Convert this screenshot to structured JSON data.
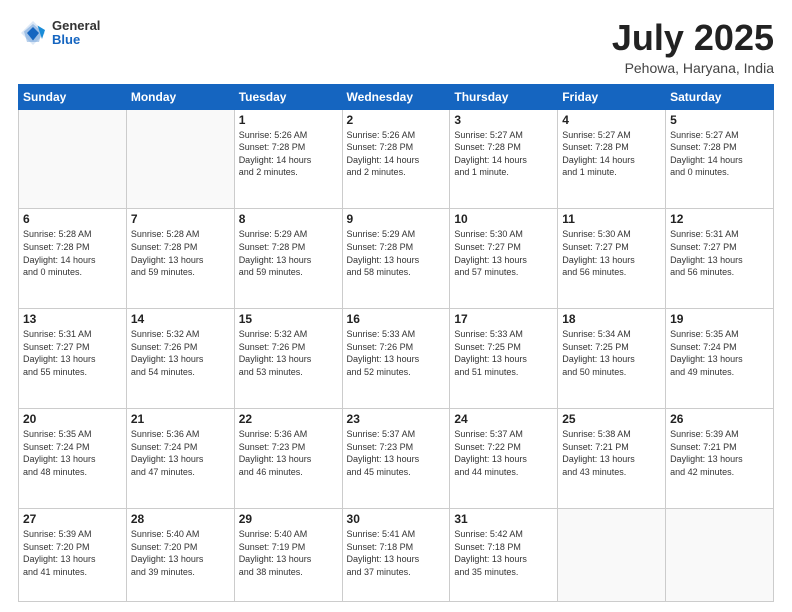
{
  "header": {
    "logo": {
      "general": "General",
      "blue": "Blue"
    },
    "title": "July 2025",
    "subtitle": "Pehowa, Haryana, India"
  },
  "weekdays": [
    "Sunday",
    "Monday",
    "Tuesday",
    "Wednesday",
    "Thursday",
    "Friday",
    "Saturday"
  ],
  "weeks": [
    [
      {
        "day": "",
        "info": ""
      },
      {
        "day": "",
        "info": ""
      },
      {
        "day": "1",
        "info": "Sunrise: 5:26 AM\nSunset: 7:28 PM\nDaylight: 14 hours\nand 2 minutes."
      },
      {
        "day": "2",
        "info": "Sunrise: 5:26 AM\nSunset: 7:28 PM\nDaylight: 14 hours\nand 2 minutes."
      },
      {
        "day": "3",
        "info": "Sunrise: 5:27 AM\nSunset: 7:28 PM\nDaylight: 14 hours\nand 1 minute."
      },
      {
        "day": "4",
        "info": "Sunrise: 5:27 AM\nSunset: 7:28 PM\nDaylight: 14 hours\nand 1 minute."
      },
      {
        "day": "5",
        "info": "Sunrise: 5:27 AM\nSunset: 7:28 PM\nDaylight: 14 hours\nand 0 minutes."
      }
    ],
    [
      {
        "day": "6",
        "info": "Sunrise: 5:28 AM\nSunset: 7:28 PM\nDaylight: 14 hours\nand 0 minutes."
      },
      {
        "day": "7",
        "info": "Sunrise: 5:28 AM\nSunset: 7:28 PM\nDaylight: 13 hours\nand 59 minutes."
      },
      {
        "day": "8",
        "info": "Sunrise: 5:29 AM\nSunset: 7:28 PM\nDaylight: 13 hours\nand 59 minutes."
      },
      {
        "day": "9",
        "info": "Sunrise: 5:29 AM\nSunset: 7:28 PM\nDaylight: 13 hours\nand 58 minutes."
      },
      {
        "day": "10",
        "info": "Sunrise: 5:30 AM\nSunset: 7:27 PM\nDaylight: 13 hours\nand 57 minutes."
      },
      {
        "day": "11",
        "info": "Sunrise: 5:30 AM\nSunset: 7:27 PM\nDaylight: 13 hours\nand 56 minutes."
      },
      {
        "day": "12",
        "info": "Sunrise: 5:31 AM\nSunset: 7:27 PM\nDaylight: 13 hours\nand 56 minutes."
      }
    ],
    [
      {
        "day": "13",
        "info": "Sunrise: 5:31 AM\nSunset: 7:27 PM\nDaylight: 13 hours\nand 55 minutes."
      },
      {
        "day": "14",
        "info": "Sunrise: 5:32 AM\nSunset: 7:26 PM\nDaylight: 13 hours\nand 54 minutes."
      },
      {
        "day": "15",
        "info": "Sunrise: 5:32 AM\nSunset: 7:26 PM\nDaylight: 13 hours\nand 53 minutes."
      },
      {
        "day": "16",
        "info": "Sunrise: 5:33 AM\nSunset: 7:26 PM\nDaylight: 13 hours\nand 52 minutes."
      },
      {
        "day": "17",
        "info": "Sunrise: 5:33 AM\nSunset: 7:25 PM\nDaylight: 13 hours\nand 51 minutes."
      },
      {
        "day": "18",
        "info": "Sunrise: 5:34 AM\nSunset: 7:25 PM\nDaylight: 13 hours\nand 50 minutes."
      },
      {
        "day": "19",
        "info": "Sunrise: 5:35 AM\nSunset: 7:24 PM\nDaylight: 13 hours\nand 49 minutes."
      }
    ],
    [
      {
        "day": "20",
        "info": "Sunrise: 5:35 AM\nSunset: 7:24 PM\nDaylight: 13 hours\nand 48 minutes."
      },
      {
        "day": "21",
        "info": "Sunrise: 5:36 AM\nSunset: 7:24 PM\nDaylight: 13 hours\nand 47 minutes."
      },
      {
        "day": "22",
        "info": "Sunrise: 5:36 AM\nSunset: 7:23 PM\nDaylight: 13 hours\nand 46 minutes."
      },
      {
        "day": "23",
        "info": "Sunrise: 5:37 AM\nSunset: 7:23 PM\nDaylight: 13 hours\nand 45 minutes."
      },
      {
        "day": "24",
        "info": "Sunrise: 5:37 AM\nSunset: 7:22 PM\nDaylight: 13 hours\nand 44 minutes."
      },
      {
        "day": "25",
        "info": "Sunrise: 5:38 AM\nSunset: 7:21 PM\nDaylight: 13 hours\nand 43 minutes."
      },
      {
        "day": "26",
        "info": "Sunrise: 5:39 AM\nSunset: 7:21 PM\nDaylight: 13 hours\nand 42 minutes."
      }
    ],
    [
      {
        "day": "27",
        "info": "Sunrise: 5:39 AM\nSunset: 7:20 PM\nDaylight: 13 hours\nand 41 minutes."
      },
      {
        "day": "28",
        "info": "Sunrise: 5:40 AM\nSunset: 7:20 PM\nDaylight: 13 hours\nand 39 minutes."
      },
      {
        "day": "29",
        "info": "Sunrise: 5:40 AM\nSunset: 7:19 PM\nDaylight: 13 hours\nand 38 minutes."
      },
      {
        "day": "30",
        "info": "Sunrise: 5:41 AM\nSunset: 7:18 PM\nDaylight: 13 hours\nand 37 minutes."
      },
      {
        "day": "31",
        "info": "Sunrise: 5:42 AM\nSunset: 7:18 PM\nDaylight: 13 hours\nand 35 minutes."
      },
      {
        "day": "",
        "info": ""
      },
      {
        "day": "",
        "info": ""
      }
    ]
  ]
}
